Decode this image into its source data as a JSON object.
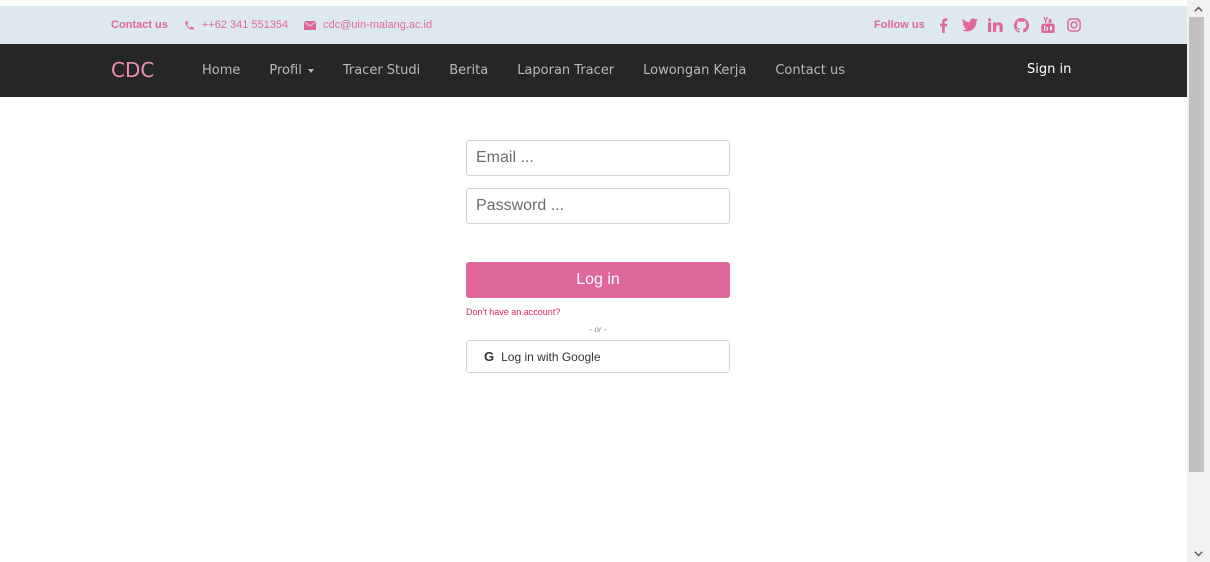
{
  "topbar": {
    "contact_label": "Contact us",
    "phone": "++62 341 551354",
    "email": "cdc@uin-malang.ac.id",
    "follow_label": "Follow us",
    "social_icons": [
      "facebook-icon",
      "twitter-icon",
      "linkedin-icon",
      "github-icon",
      "youtube-icon",
      "instagram-icon"
    ]
  },
  "navbar": {
    "brand": "CDC",
    "items": [
      {
        "label": "Home"
      },
      {
        "label": "Profil"
      },
      {
        "label": "Tracer Studi"
      },
      {
        "label": "Berita"
      },
      {
        "label": "Laporan Tracer"
      },
      {
        "label": "Lowongan Kerja"
      },
      {
        "label": "Contact us"
      }
    ],
    "signin": "Sign in"
  },
  "form": {
    "email_placeholder": "Email ...",
    "password_placeholder": "Password ...",
    "login_label": "Log in",
    "no_account": "Don't have an account?",
    "or": "- or -",
    "google_label": "Log in with Google",
    "google_glyph": "G"
  },
  "colors": {
    "accent": "#e0679b",
    "brand": "#ef8fb8",
    "navbar_bg": "#262626",
    "topbar_bg": "#dde8ef"
  }
}
